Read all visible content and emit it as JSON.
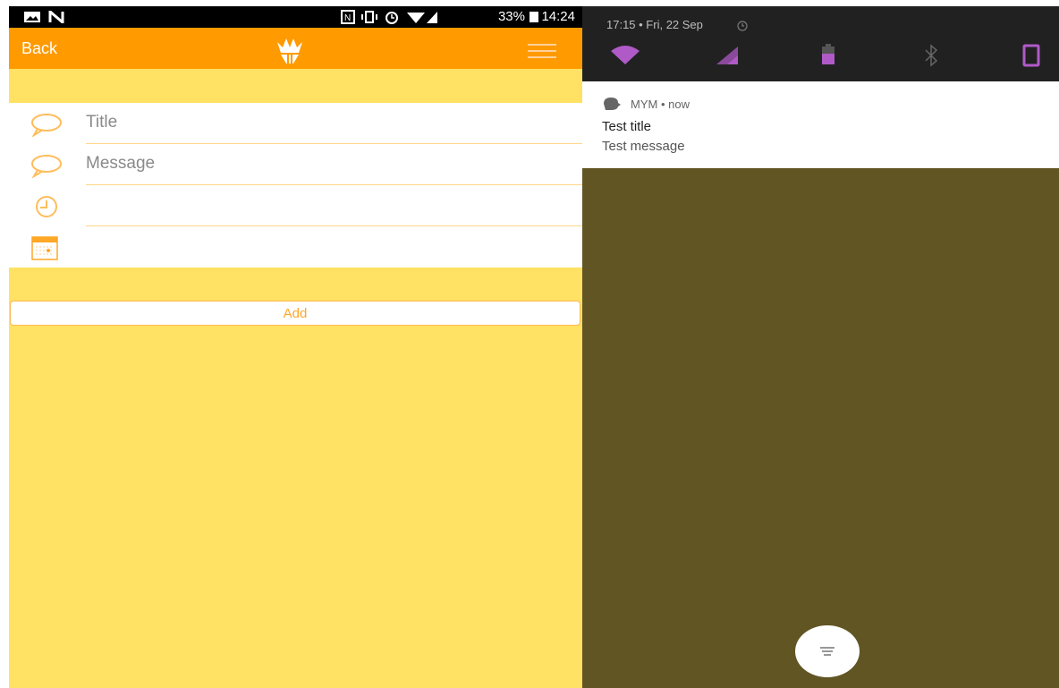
{
  "left_phone": {
    "status_bar": {
      "battery": "33%",
      "time": "14:24"
    },
    "app_bar": {
      "back_label": "Back"
    },
    "form": {
      "title_placeholder": "Title",
      "message_placeholder": "Message",
      "time_value": "",
      "date_value": ""
    },
    "add_label": "Add",
    "colors": {
      "app_bar": "#ff9a00",
      "background": "#ffe164",
      "accent": "#ffa726"
    }
  },
  "right_phone": {
    "status_bar": {
      "datetime": "17:15 • Fri, 22 Sep"
    },
    "quick_settings": [
      "wifi-icon",
      "signal-icon",
      "battery-icon",
      "bluetooth-icon",
      "rotate-icon"
    ],
    "notification": {
      "app_line": "MYM • now",
      "title": "Test title",
      "message": "Test message"
    },
    "colors": {
      "accent": "#b05ac8",
      "background": "#615524"
    }
  }
}
